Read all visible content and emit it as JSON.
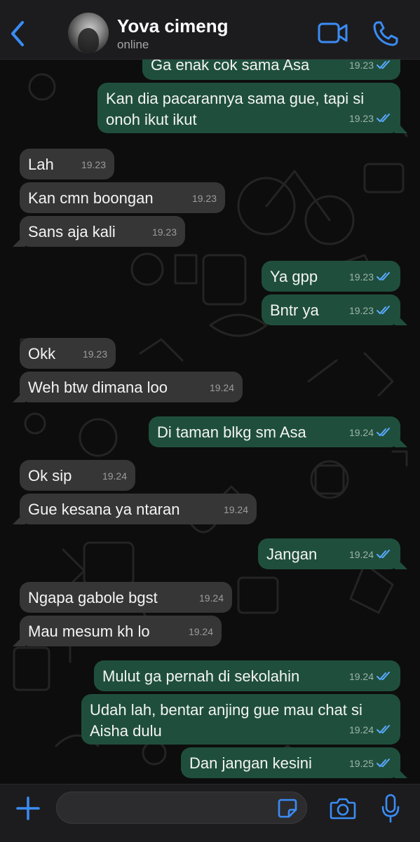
{
  "header": {
    "contact_name": "Yova cimeng",
    "status": "online",
    "icons": [
      "back-chevron-icon",
      "video-camera-icon",
      "phone-icon"
    ]
  },
  "colors": {
    "accent": "#3b8cf5",
    "incoming_bubble": "#363636",
    "outgoing_bubble": "#1f4f3c",
    "read_ticks": "#5aa9ff"
  },
  "messages": [
    {
      "direction": "out",
      "text": "Ga enak cok sama Asa",
      "time": "19.23",
      "read": true
    },
    {
      "direction": "out",
      "text": "Kan dia pacarannya sama gue, tapi si onoh ikut ikut",
      "time": "19.23",
      "read": true
    },
    {
      "direction": "in",
      "text": "Lah",
      "time": "19.23"
    },
    {
      "direction": "in",
      "text": "Kan cmn boongan",
      "time": "19.23"
    },
    {
      "direction": "in",
      "text": "Sans aja kali",
      "time": "19.23"
    },
    {
      "direction": "out",
      "text": "Ya gpp",
      "time": "19.23",
      "read": true
    },
    {
      "direction": "out",
      "text": "Bntr ya",
      "time": "19.23",
      "read": true
    },
    {
      "direction": "in",
      "text": "Okk",
      "time": "19.23"
    },
    {
      "direction": "in",
      "text": "Weh btw dimana loo",
      "time": "19.24"
    },
    {
      "direction": "out",
      "text": "Di taman blkg sm Asa",
      "time": "19.24",
      "read": true
    },
    {
      "direction": "in",
      "text": "Ok sip",
      "time": "19.24"
    },
    {
      "direction": "in",
      "text": "Gue kesana ya ntaran",
      "time": "19.24"
    },
    {
      "direction": "out",
      "text": "Jangan",
      "time": "19.24",
      "read": true
    },
    {
      "direction": "in",
      "text": "Ngapa gabole bgst",
      "time": "19.24"
    },
    {
      "direction": "in",
      "text": "Mau mesum kh lo",
      "time": "19.24"
    },
    {
      "direction": "out",
      "text": "Mulut ga pernah di sekolahin",
      "time": "19.24",
      "read": true
    },
    {
      "direction": "out",
      "text": "Udah lah, bentar anjing gue mau chat si Aisha dulu",
      "time": "19.24",
      "read": true
    },
    {
      "direction": "out",
      "text": "Dan jangan kesini",
      "time": "19.25",
      "read": true
    }
  ],
  "composer": {
    "placeholder": "",
    "icons": [
      "plus-icon",
      "sticker-icon",
      "camera-icon",
      "microphone-icon"
    ]
  }
}
